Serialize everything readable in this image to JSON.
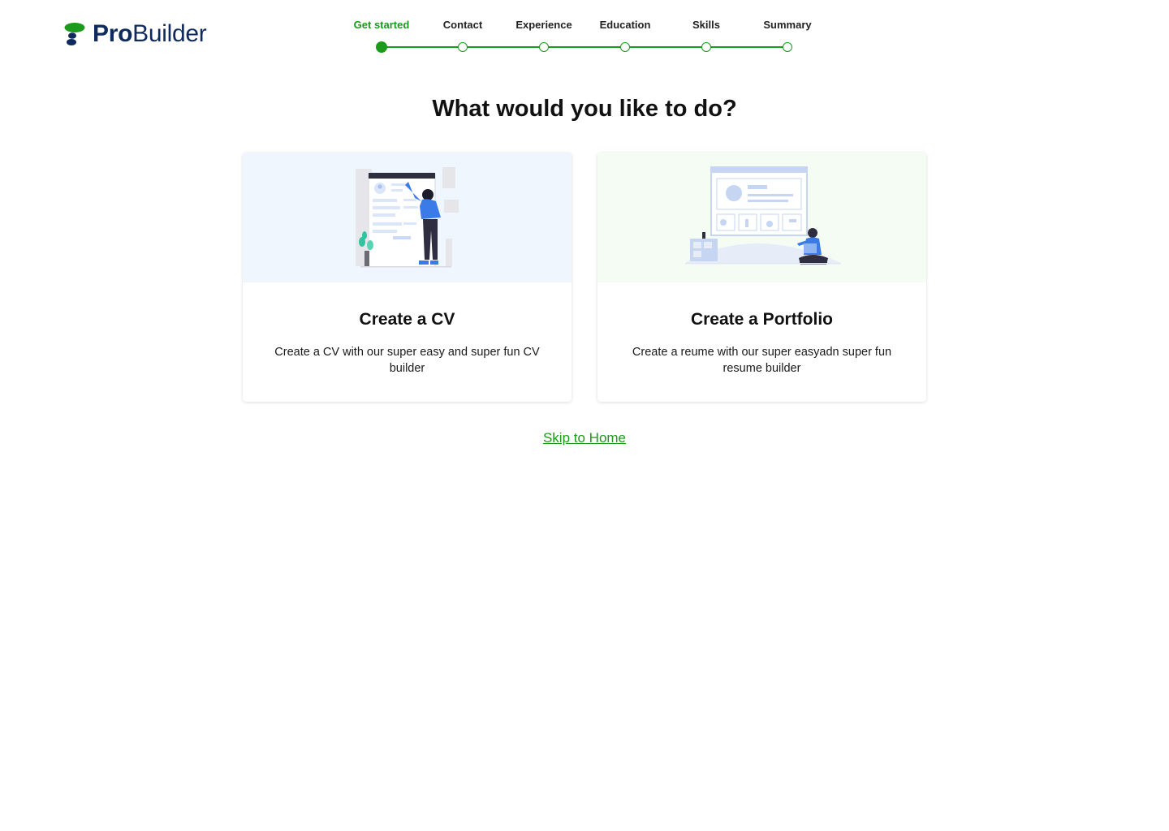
{
  "brand": {
    "name_bold": "Pro",
    "name_regular": "Builder",
    "colors": {
      "primary": "#0f2a5c",
      "accent": "#1b9a1b"
    }
  },
  "stepper": {
    "steps": [
      {
        "label": "Get started",
        "active": true
      },
      {
        "label": "Contact",
        "active": false
      },
      {
        "label": "Experience",
        "active": false
      },
      {
        "label": "Education",
        "active": false
      },
      {
        "label": "Skills",
        "active": false
      },
      {
        "label": "Summary",
        "active": false
      }
    ]
  },
  "main": {
    "heading": "What would you like to do?",
    "cards": [
      {
        "title": "Create a CV",
        "description": "Create a CV with our super easy and super fun CV builder",
        "illustration": "person-at-cv-board-illustration"
      },
      {
        "title": "Create a Portfolio",
        "description": "Create a reume with our super easyadn super fun resume builder",
        "illustration": "person-with-laptop-portfolio-illustration"
      }
    ],
    "skip_link": "Skip to Home"
  }
}
